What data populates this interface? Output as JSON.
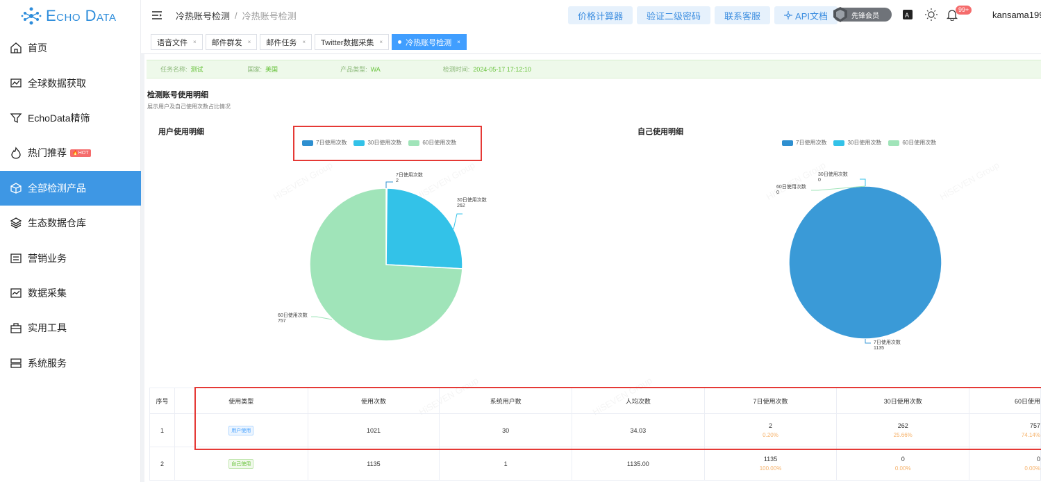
{
  "brand": {
    "logo_text": "Echo Data"
  },
  "sidebar": {
    "items": [
      {
        "label": "首页",
        "icon": "home-icon"
      },
      {
        "label": "全球数据获取",
        "icon": "chart-monitor-icon"
      },
      {
        "label": "EchoData精筛",
        "icon": "filter-icon"
      },
      {
        "label": "热门推荐",
        "icon": "flame-icon",
        "badge": "🔥HOT"
      },
      {
        "label": "全部检测产品",
        "icon": "box-icon",
        "active": true
      },
      {
        "label": "生态数据仓库",
        "icon": "layers-icon"
      },
      {
        "label": "营销业务",
        "icon": "list-icon"
      },
      {
        "label": "数据采集",
        "icon": "collect-icon"
      },
      {
        "label": "实用工具",
        "icon": "briefcase-icon"
      },
      {
        "label": "系统服务",
        "icon": "server-icon"
      }
    ]
  },
  "header": {
    "breadcrumb": [
      "冷热账号检测",
      "冷热账号检测"
    ],
    "actions": [
      "价格计算器",
      "验证二级密码",
      "联系客服",
      "API文档"
    ],
    "vip_label": "先锋会员",
    "notification_count": "99+",
    "username": "kansama199"
  },
  "tabs": [
    {
      "label": "语音文件",
      "active": false
    },
    {
      "label": "邮件群发",
      "active": false
    },
    {
      "label": "邮件任务",
      "active": false
    },
    {
      "label": "Twitter数据采集",
      "active": false
    },
    {
      "label": "冷热账号检测",
      "active": true
    }
  ],
  "task_info": {
    "name_label": "任务名称:",
    "name": "测试",
    "country_label": "国家:",
    "country": "美国",
    "product_label": "产品类型:",
    "product": "WA",
    "time_label": "检测时间:",
    "time": "2024-05-17 17:12:10"
  },
  "section": {
    "title": "检测账号使用明细",
    "subtitle": "展示用户及自己使用次数占比情况"
  },
  "chart_data": [
    {
      "type": "pie",
      "title": "用户使用明细",
      "legend": [
        "7日使用次数",
        "30日使用次数",
        "60日使用次数"
      ],
      "legend_position": "top",
      "categories": [
        "7日使用次数",
        "30日使用次数",
        "60日使用次数"
      ],
      "values": [
        2,
        262,
        757
      ],
      "colors": [
        "#2e8fd0",
        "#33c2e8",
        "#a0e4b9"
      ]
    },
    {
      "type": "pie",
      "title": "自己使用明细",
      "legend": [
        "7日使用次数",
        "30日使用次数",
        "60日使用次数"
      ],
      "legend_position": "top",
      "categories": [
        "7日使用次数",
        "30日使用次数",
        "60日使用次数"
      ],
      "values": [
        1135,
        0,
        0
      ],
      "colors": [
        "#3a9ad7",
        "#33c2e8",
        "#a0e4b9"
      ]
    }
  ],
  "table": {
    "headers": [
      "序号",
      "使用类型",
      "使用次数",
      "系统用户数",
      "人均次数",
      "7日使用次数",
      "30日使用次数",
      "60日使用"
    ],
    "rows": [
      {
        "idx": "1",
        "type": "用户使用",
        "count": "1021",
        "users": "30",
        "avg": "34.03",
        "d7": "2",
        "d7_pct": "0.20%",
        "d30": "262",
        "d30_pct": "25.66%",
        "d60": "757",
        "d60_pct": "74.14%"
      },
      {
        "idx": "2",
        "type": "自己使用",
        "count": "1135",
        "users": "1",
        "avg": "1135.00",
        "d7": "1135",
        "d7_pct": "100.00%",
        "d30": "0",
        "d30_pct": "0.00%",
        "d60": "0",
        "d60_pct": "0.00%"
      }
    ]
  },
  "watermark": "HiSEVEN Group"
}
